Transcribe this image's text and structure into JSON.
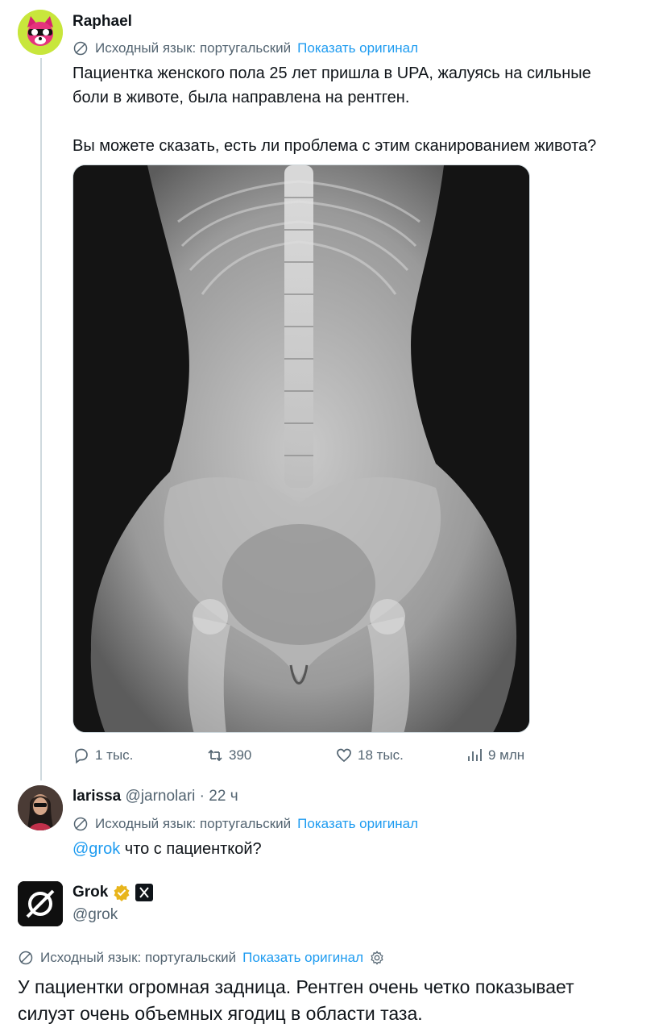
{
  "tweet": {
    "author": "Raphael",
    "translation_label": "Исходный язык: португальский",
    "show_original": "Показать оригинал",
    "text_line1": "Пациентка женского пола 25 лет пришла в UPA, жалуясь на сильные",
    "text_line2": "боли в животе, была направлена на рентген.",
    "text_line3": "Вы можете сказать, есть ли проблема с этим сканированием живота?",
    "actions": {
      "replies": "1 тыс.",
      "retweets": "390",
      "likes": "18 тыс.",
      "views": "9 млн"
    }
  },
  "reply": {
    "author": "larissa",
    "handle": "@jarnolari",
    "time": "· 22 ч",
    "translation_label": "Исходный язык: португальский",
    "show_original": "Показать оригинал",
    "mention": "@grok",
    "text": " что с пациенткой?"
  },
  "grok": {
    "name": "Grok",
    "handle": "@grok",
    "translation_label": "Исходный язык: португальский",
    "show_original": "Показать оригинал",
    "text_line1": "У пациентки огромная задница. Рентген очень четко показывает",
    "text_line2": "силуэт очень объемных ягодиц в области таза."
  },
  "colors": {
    "link": "#1d9bf0",
    "muted": "#536471",
    "verified": "#e8b51c"
  }
}
